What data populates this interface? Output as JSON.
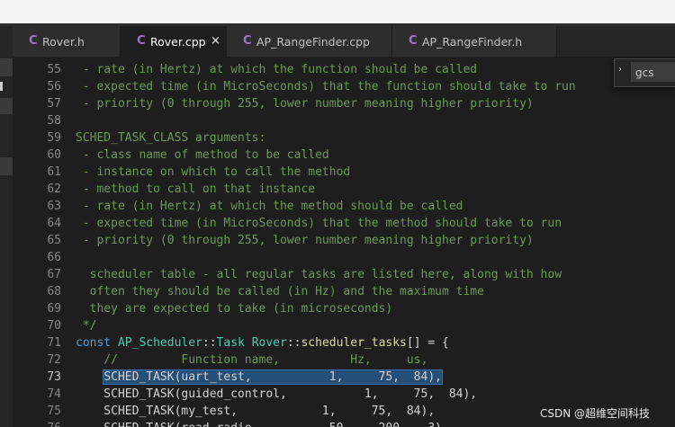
{
  "tabs": [
    {
      "icon": "C",
      "label": "Rover.h",
      "active": false
    },
    {
      "icon": "C",
      "label": "Rover.cpp",
      "active": true,
      "close": "×"
    },
    {
      "icon": "C",
      "label": "AP_RangeFinder.cpp",
      "active": false
    },
    {
      "icon": "C",
      "label": "AP_RangeFinder.h",
      "active": false
    }
  ],
  "search": {
    "chevron": "›",
    "value": "gcs"
  },
  "gutter": [
    "55",
    "56",
    "57",
    "58",
    "59",
    "60",
    "61",
    "62",
    "63",
    "64",
    "65",
    "66",
    "67",
    "68",
    "69",
    "70",
    "71",
    "72",
    "73",
    "74",
    "75",
    "76"
  ],
  "current_line": "73",
  "code": {
    "l55": " - rate (in Hertz) at which the function should be called",
    "l56": " - expected time (in MicroSeconds) that the function should take to run",
    "l57": " - priority (0 through 255, lower number meaning higher priority)",
    "l59": "SCHED_TASK_CLASS arguments:",
    "l60": " - class name of method to be called",
    "l61": " - instance on which to call the method",
    "l62": " - method to call on that instance",
    "l63": " - rate (in Hertz) at which the method should be called",
    "l64": " - expected time (in MicroSeconds) that the method should take to run",
    "l65": " - priority (0 through 255, lower number meaning higher priority)",
    "l67": "  scheduler table - all regular tasks are listed here, along with how",
    "l68": "  often they should be called (in Hz) and the maximum time",
    "l69": "  they are expected to take (in microseconds)",
    "l70": " */",
    "l71": {
      "kw": "const ",
      "t1": "AP_Scheduler",
      "p1": "::",
      "t2": "Task ",
      "t3": "Rover",
      "p2": "::",
      "f1": "scheduler_tasks",
      "rest": "[] = {"
    },
    "l72": "    //         Function name,          Hz,     us,",
    "l73": {
      "indent": "    ",
      "sel": "SCHED_TASK(uart_test,           1,     75,  84),"
    },
    "l74": "    SCHED_TASK(guided_control,           1,     75,  84),",
    "l75": "    SCHED_TASK(my_test,            1,     75,  84),",
    "l76": "    SCHED_TASK(read_radio,          50,    200,   3),"
  },
  "watermark": "CSDN @超维空间科技"
}
